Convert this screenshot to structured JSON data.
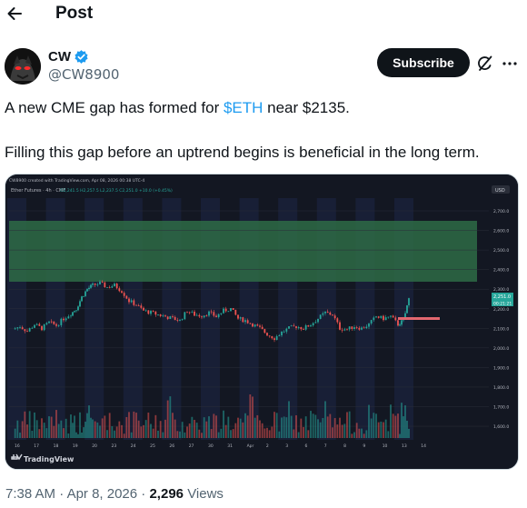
{
  "header": {
    "title": "Post"
  },
  "author": {
    "name": "CW",
    "handle": "@CW8900"
  },
  "actions": {
    "subscribe": "Subscribe"
  },
  "post": {
    "line1_pre": "A new CME gap has formed for ",
    "cashtag": "$ETH",
    "line1_post": " near $2135.",
    "line2": "Filling this gap before an uptrend begins is beneficial in the long term."
  },
  "chart": {
    "created_note": "CW8900 created with TradingView.com, Apr 08, 2026 00:38 UTC-4",
    "symbol_line": "Ether Futures · 4h · CME",
    "ohlc": "O2,241.5 H2,257.5 L2,237.5 C2,251.0 +10.0 (+0.45%)",
    "currency": "USD",
    "price_ticks": [
      "2,700.0",
      "2,600.0",
      "2,500.0",
      "2,400.0",
      "2,300.0",
      "2,200.0",
      "2,100.0",
      "2,000.0",
      "1,900.0",
      "1,800.0",
      "1,700.0",
      "1,600.0"
    ],
    "last_price": "2,251.0",
    "countdown": "00:21:21",
    "x_ticks": [
      "16",
      "17",
      "18",
      "19",
      "20",
      "23",
      "24",
      "25",
      "26",
      "27",
      "30",
      "31",
      "Apr",
      "2",
      "3",
      "6",
      "7",
      "8",
      "9",
      "10",
      "13",
      "14"
    ],
    "brand": "TradingView",
    "colors": {
      "bg": "#131722",
      "band": "#1c2545",
      "gap_zone": "#2e6b45",
      "up": "#26a69a",
      "down": "#ef5350",
      "marker": "#e2676f"
    }
  },
  "meta": {
    "time": "7:38 AM",
    "sep": "·",
    "date": "Apr 8, 2026",
    "views": "2,296",
    "views_label": "Views"
  }
}
